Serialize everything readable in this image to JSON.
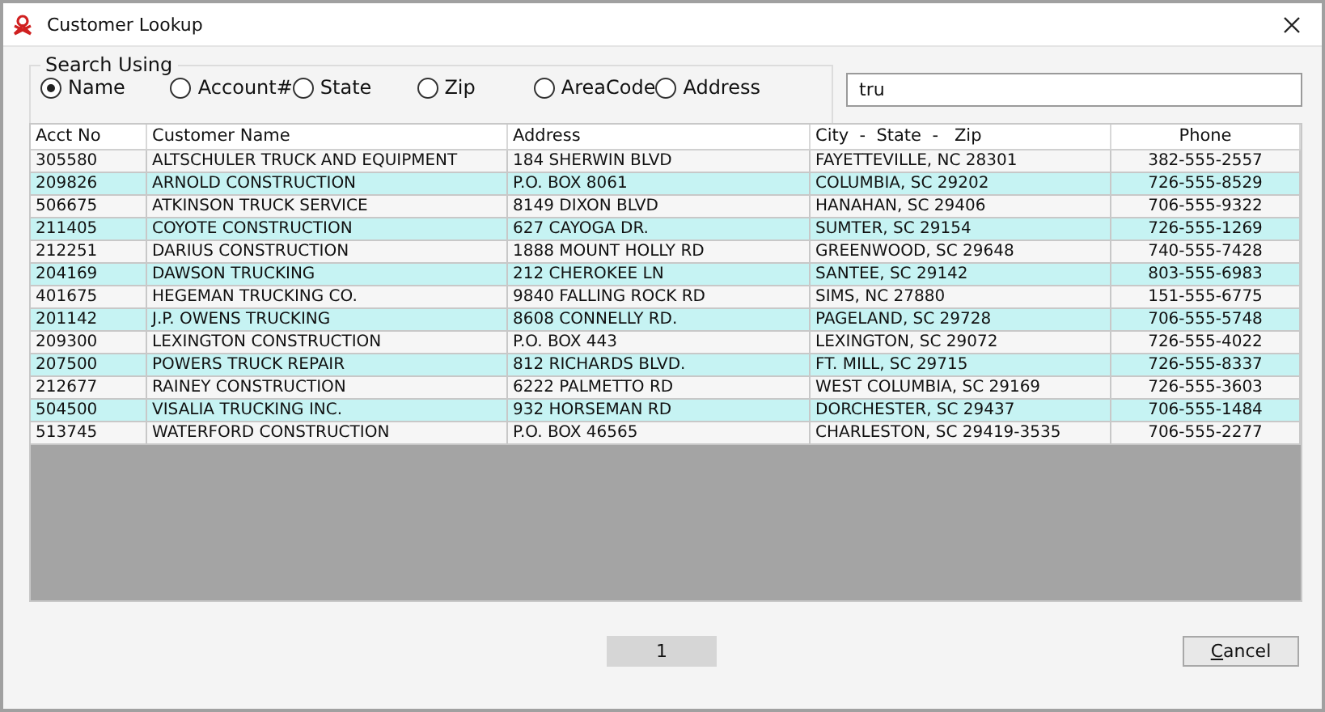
{
  "window": {
    "title": "Customer Lookup"
  },
  "search": {
    "group_title": "Search Using",
    "options": [
      {
        "label": "Name",
        "selected": true
      },
      {
        "label": "Account#",
        "selected": false
      },
      {
        "label": "State",
        "selected": false
      },
      {
        "label": "Zip",
        "selected": false
      },
      {
        "label": "AreaCode",
        "selected": false
      },
      {
        "label": "Address",
        "selected": false
      }
    ],
    "value": "tru"
  },
  "table": {
    "columns": [
      "Acct No",
      "Customer Name",
      "Address",
      "City  -  State  -   Zip",
      "Phone"
    ],
    "rows": [
      [
        "305580",
        "ALTSCHULER TRUCK AND EQUIPMENT",
        "184 SHERWIN BLVD",
        "FAYETTEVILLE, NC 28301",
        "382-555-2557"
      ],
      [
        "209826",
        "ARNOLD CONSTRUCTION",
        "P.O. BOX 8061",
        "COLUMBIA, SC 29202",
        "726-555-8529"
      ],
      [
        "506675",
        "ATKINSON TRUCK SERVICE",
        "8149 DIXON BLVD",
        "HANAHAN, SC 29406",
        "706-555-9322"
      ],
      [
        "211405",
        "COYOTE CONSTRUCTION",
        "627 CAYOGA DR.",
        "SUMTER, SC 29154",
        "726-555-1269"
      ],
      [
        "212251",
        "DARIUS CONSTRUCTION",
        "1888 MOUNT HOLLY RD",
        "GREENWOOD, SC 29648",
        "740-555-7428"
      ],
      [
        "204169",
        "DAWSON TRUCKING",
        "212 CHEROKEE LN",
        "SANTEE, SC 29142",
        "803-555-6983"
      ],
      [
        "401675",
        "HEGEMAN TRUCKING CO.",
        "9840 FALLING ROCK RD",
        "SIMS, NC 27880",
        "151-555-6775"
      ],
      [
        "201142",
        "J.P. OWENS TRUCKING",
        "8608 CONNELLY RD.",
        "PAGELAND, SC 29728",
        "706-555-5748"
      ],
      [
        "209300",
        "LEXINGTON CONSTRUCTION",
        "P.O. BOX 443",
        "LEXINGTON, SC 29072",
        "726-555-4022"
      ],
      [
        "207500",
        "POWERS TRUCK REPAIR",
        "812 RICHARDS BLVD.",
        "FT. MILL, SC 29715",
        "726-555-8337"
      ],
      [
        "212677",
        "RAINEY CONSTRUCTION",
        "6222 PALMETTO RD",
        "WEST COLUMBIA, SC 29169",
        "726-555-3603"
      ],
      [
        "504500",
        "VISALIA TRUCKING INC.",
        "932 HORSEMAN RD",
        "DORCHESTER, SC 29437",
        "706-555-1484"
      ],
      [
        "513745",
        "WATERFORD CONSTRUCTION",
        "P.O. BOX 46565",
        "CHARLESTON, SC 29419-3535",
        "706-555-2277"
      ]
    ]
  },
  "page_label": "1",
  "buttons": [
    "Cancel"
  ]
}
